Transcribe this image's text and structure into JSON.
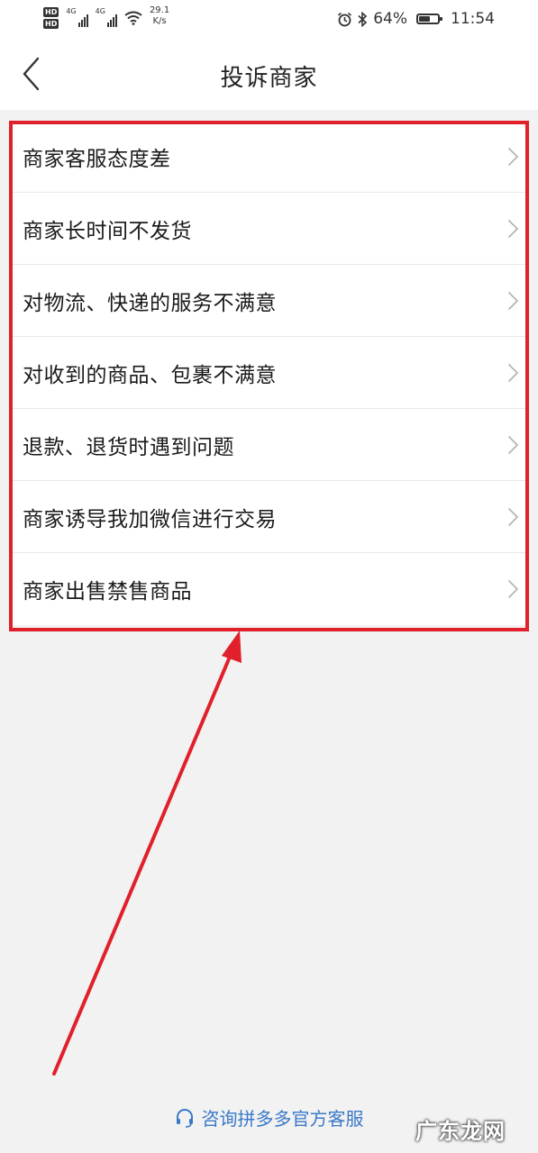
{
  "status_bar": {
    "hd_1": "HD",
    "hd_2": "HD",
    "network_1": "4G",
    "network_2": "4G",
    "speed_value": "29.1",
    "speed_unit": "K/s",
    "battery": "64%",
    "battery_level": 0.64,
    "time": "11:54"
  },
  "header": {
    "title": "投诉商家"
  },
  "complaint_options": [
    {
      "label": "商家客服态度差"
    },
    {
      "label": "商家长时间不发货"
    },
    {
      "label": "对物流、快递的服务不满意"
    },
    {
      "label": "对收到的商品、包裹不满意"
    },
    {
      "label": "退款、退货时遇到问题"
    },
    {
      "label": "商家诱导我加微信进行交易"
    },
    {
      "label": "商家出售禁售商品"
    }
  ],
  "footer": {
    "support_label": "咨询拼多多官方客服"
  },
  "watermark": "广东龙网",
  "colors": {
    "annotation_red": "#e0202a",
    "link_blue": "#3a79c8"
  },
  "icons": {
    "back": "chevron-left-icon",
    "item_arrow": "chevron-right-icon",
    "support": "headset-icon"
  }
}
